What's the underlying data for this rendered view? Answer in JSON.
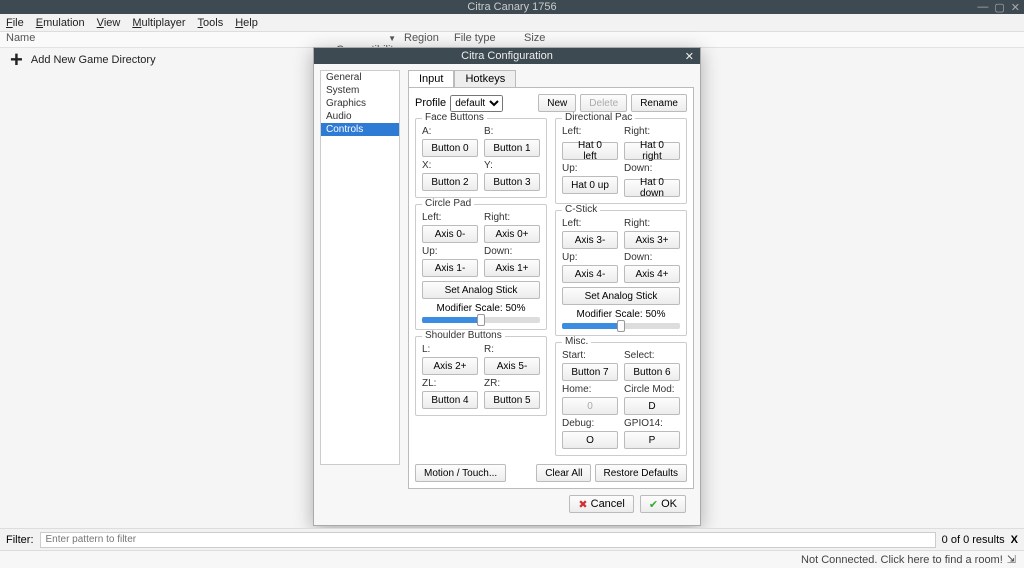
{
  "window": {
    "title": "Citra Canary 1756"
  },
  "menubar": [
    "File",
    "Emulation",
    "View",
    "Multiplayer",
    "Tools",
    "Help"
  ],
  "columns": {
    "name": "Name",
    "compat": "Compatibility",
    "region": "Region",
    "filetype": "File type",
    "size": "Size"
  },
  "adddir": "Add New Game Directory",
  "dialog": {
    "title": "Citra Configuration",
    "categories": [
      "General",
      "System",
      "Graphics",
      "Audio",
      "Controls"
    ],
    "selected_cat": "Controls",
    "tabs": {
      "input": "Input",
      "hotkeys": "Hotkeys",
      "active": "Input"
    },
    "profile_label": "Profile",
    "profile_value": "default",
    "buttons": {
      "new": "New",
      "delete": "Delete",
      "rename": "Rename",
      "motion": "Motion / Touch...",
      "clear": "Clear All",
      "restore": "Restore Defaults",
      "cancel": "Cancel",
      "ok": "OK"
    },
    "groups": {
      "face": {
        "title": "Face Buttons",
        "a_label": "A:",
        "a_val": "Button 0",
        "b_label": "B:",
        "b_val": "Button 1",
        "x_label": "X:",
        "x_val": "Button 2",
        "y_label": "Y:",
        "y_val": "Button 3"
      },
      "dpad": {
        "title": "Directional Pac",
        "l_label": "Left:",
        "l_val": "Hat 0 left",
        "r_label": "Right:",
        "r_val": "Hat 0 right",
        "u_label": "Up:",
        "u_val": "Hat 0 up",
        "d_label": "Down:",
        "d_val": "Hat 0 down"
      },
      "circle": {
        "title": "Circle Pad",
        "l_label": "Left:",
        "l_val": "Axis 0-",
        "r_label": "Right:",
        "r_val": "Axis 0+",
        "u_label": "Up:",
        "u_val": "Axis 1-",
        "d_label": "Down:",
        "d_val": "Axis 1+",
        "analog": "Set Analog Stick",
        "scale": "Modifier Scale: 50%"
      },
      "cstick": {
        "title": "C-Stick",
        "l_label": "Left:",
        "l_val": "Axis 3-",
        "r_label": "Right:",
        "r_val": "Axis 3+",
        "u_label": "Up:",
        "u_val": "Axis 4-",
        "d_label": "Down:",
        "d_val": "Axis 4+",
        "analog": "Set Analog Stick",
        "scale": "Modifier Scale: 50%"
      },
      "shoulder": {
        "title": "Shoulder Buttons",
        "l_label": "L:",
        "l_val": "Axis 2+",
        "r_label": "R:",
        "r_val": "Axis 5-",
        "zl_label": "ZL:",
        "zl_val": "Button 4",
        "zr_label": "ZR:",
        "zr_val": "Button 5"
      },
      "misc": {
        "title": "Misc.",
        "start_label": "Start:",
        "start_val": "Button 7",
        "sel_label": "Select:",
        "sel_val": "Button 6",
        "home_label": "Home:",
        "home_val": "0",
        "mod_label": "Circle Mod:",
        "mod_val": "D",
        "dbg_label": "Debug:",
        "dbg_val": "O",
        "gpio_label": "GPIO14:",
        "gpio_val": "P"
      }
    }
  },
  "filter": {
    "label": "Filter:",
    "placeholder": "Enter pattern to filter",
    "results": "0 of 0 results",
    "close": "X"
  },
  "status": {
    "text": "Not Connected. Click here to find a room!"
  }
}
